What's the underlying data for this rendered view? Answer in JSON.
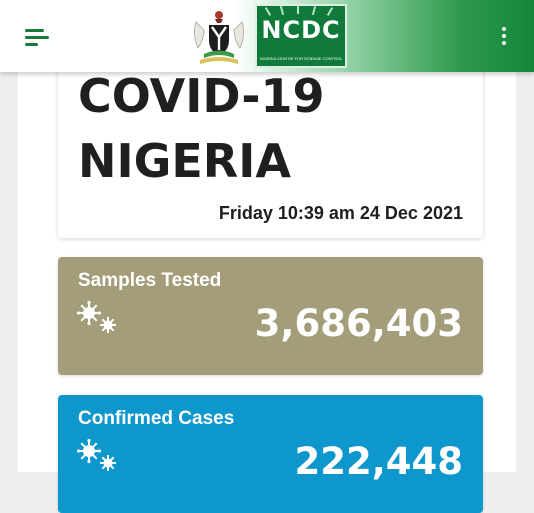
{
  "colors": {
    "header_green": "#167c3c",
    "logo_green": "#0f7a3a",
    "title_text": "#1f1f1f",
    "samples_card": "#a39d79",
    "confirmed_card": "#0e97cc",
    "panel_background": "#ffffff",
    "page_background": "#efefef"
  },
  "icons": {
    "menu": "hamburger-menu-icon",
    "more": "vertical-dots-icon",
    "virus": "virus-particles-icon",
    "coat_of_arms": "nigeria-coat-of-arms",
    "logo": "ncdc-logo"
  },
  "header": {
    "logo_text": "NCDC",
    "logo_subtitle": "NIGERIA CENTRE FOR DISEASE CONTROL"
  },
  "title_card": {
    "line1": "COVID-19",
    "line2": "NIGERIA",
    "timestamp": "Friday 10:39 am 24 Dec 2021"
  },
  "stats": [
    {
      "label": "Samples Tested",
      "value": "3,686,403"
    },
    {
      "label": "Confirmed Cases",
      "value": "222,448"
    }
  ]
}
